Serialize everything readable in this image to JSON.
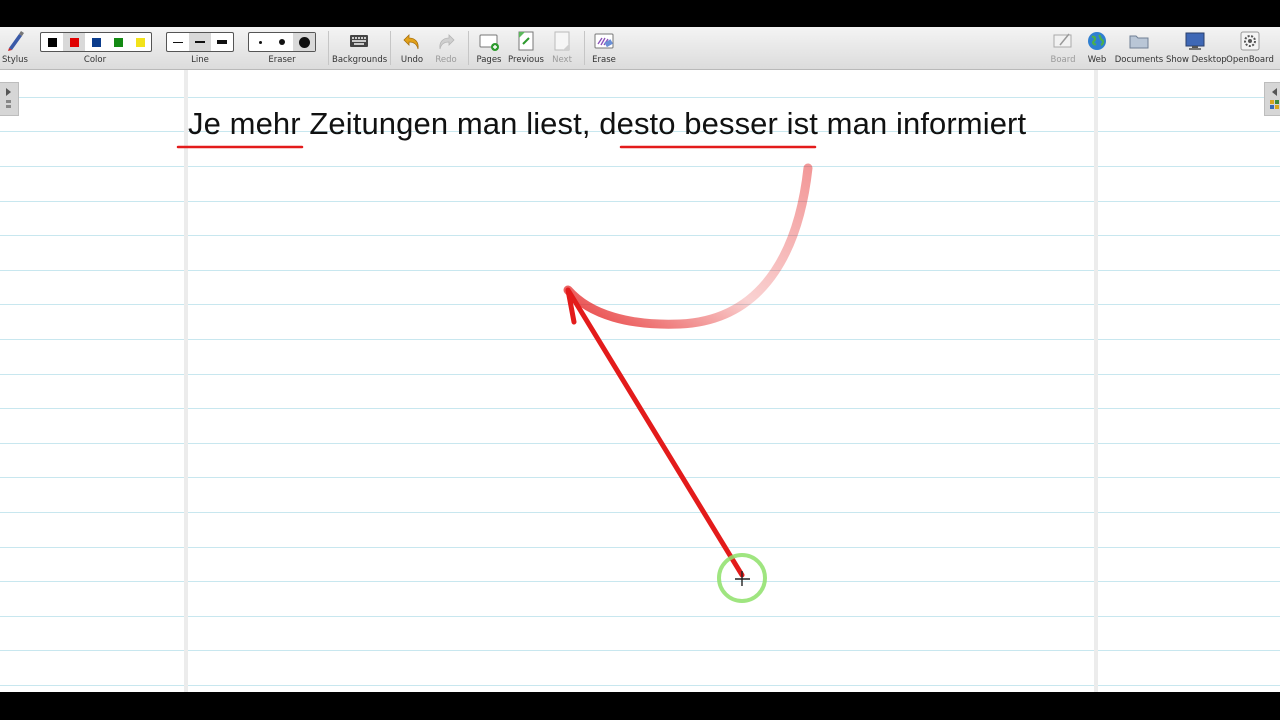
{
  "toolbar": {
    "stylus_label": "Stylus",
    "color_label": "Color",
    "line_label": "Line",
    "eraser_label": "Eraser",
    "backgrounds_label": "Backgrounds",
    "undo_label": "Undo",
    "redo_label": "Redo",
    "pages_label": "Pages",
    "previous_label": "Previous",
    "next_label": "Next",
    "erase_label": "Erase",
    "board_label": "Board",
    "web_label": "Web",
    "documents_label": "Documents",
    "show_desktop_label": "Show Desktop",
    "openboard_label": "OpenBoard",
    "colors": [
      "#000000",
      "#e00000",
      "#0b3c8c",
      "#138a13",
      "#f2e21a"
    ]
  },
  "board": {
    "text": "Je mehr Zeitungen man liest, desto besser ist man informiert",
    "ink_color": "#e31b1b",
    "cursor_ring_color": "#8ee06a",
    "rule_color": "#c8e7ef"
  }
}
